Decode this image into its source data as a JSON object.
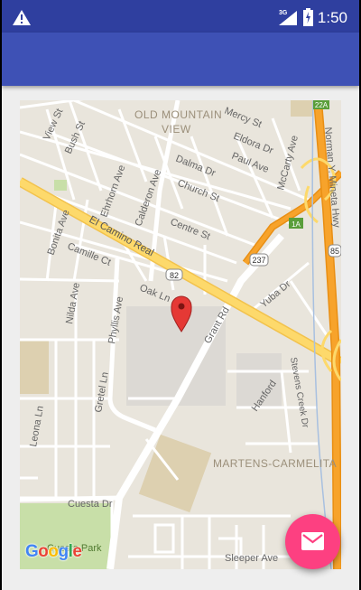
{
  "status_bar": {
    "time": "1:50",
    "network": "3G",
    "icons": [
      "warning-icon",
      "signal-icon",
      "battery-charging-icon"
    ]
  },
  "app_bar": {
    "title": ""
  },
  "map": {
    "pin_icon": "map-pin-icon",
    "labels": {
      "old_mountain_view_1": "OLD MOUNTAIN",
      "old_mountain_view_2": "VIEW",
      "mercy_st": "Mercy St",
      "eldora_dr": "Eldora Dr",
      "paul_ave": "Paul Ave",
      "mccarty_ave": "McCarty Ave",
      "norman_mineta": "Norman Y. Mineta Hwy",
      "view_st": "View St",
      "bush_st": "Bush St",
      "ehrhorn_ave": "Ehrhorn Ave",
      "calderon_ave": "Calderon Ave",
      "dalma_dr": "Dalma Dr",
      "church_st": "Church St",
      "bonita_ave": "Bonita Ave",
      "el_camino_real": "El Camino Real",
      "centre_st": "Centre St",
      "camille_ct": "Camille Ct",
      "nilda_ave": "Nilda Ave",
      "oak_ln": "Oak Ln",
      "phyllis_ave": "Phyllis Ave",
      "grant_rd": "Grant Rd",
      "yuba_dr": "Yuba Dr",
      "gretel_ln": "Gretel Ln",
      "hanford": "Hanford",
      "stevens_creek": "Stevens Creek Dr",
      "leona_ln": "Leona Ln",
      "martens_carmelita": "MARTENS-CARMELITA",
      "cuesta_dr": "Cuesta Dr",
      "cuesta_park": "Cuesta Park",
      "sleeper_ave": "Sleeper Ave"
    },
    "shields": {
      "shield_82": "82",
      "shield_237": "237",
      "shield_85": "85",
      "exit_22a": "22A",
      "exit_1a": "1A"
    },
    "google_logo": {
      "G": "G",
      "o1": "o",
      "o2": "o",
      "g": "g",
      "l": "l",
      "e": "e"
    }
  },
  "fab": {
    "icon": "email-icon"
  },
  "colors": {
    "status_bar": "#2f3f9f",
    "app_bar": "#3e51b5",
    "fab": "#fd4081",
    "map_bg": "#e9e5dc",
    "highway_orange": "#f7a32b",
    "main_road_yellow": "#fdd96b",
    "park_green": "#c8dfa8",
    "pin_red": "#e53935"
  }
}
